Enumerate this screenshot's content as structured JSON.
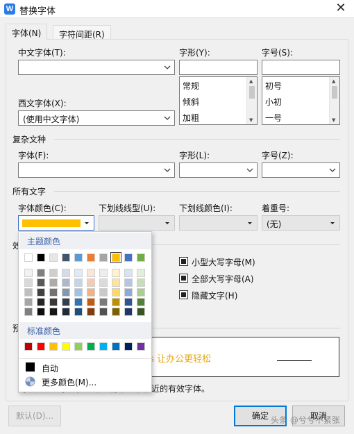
{
  "window": {
    "title": "替换字体",
    "app_icon_letter": "W"
  },
  "tabs": [
    {
      "label": "字体(N)"
    },
    {
      "label": "字符间距(R)"
    }
  ],
  "font": {
    "chinese_label": "中文字体(T):",
    "chinese_value": "",
    "western_label": "西文字体(X):",
    "western_value": "(使用中文字体)",
    "style_label": "字形(Y):",
    "style_value": "",
    "style_options": [
      "常规",
      "倾斜",
      "加粗"
    ],
    "size_label": "字号(S):",
    "size_value": "",
    "size_options": [
      "初号",
      "小初",
      "一号"
    ]
  },
  "complex": {
    "section": "复杂文种",
    "font_label": "字体(F):",
    "style_label": "字形(L):",
    "size_label": "字号(Z):"
  },
  "all_text": {
    "section": "所有文字",
    "color_label": "字体颜色(C):",
    "color_value": "#ffc000",
    "underline_type_label": "下划线线型(U):",
    "underline_color_label": "下划线颜色(I):",
    "emphasis_label": "着重号:",
    "emphasis_value": "(无)"
  },
  "effects": {
    "section_partial": "效",
    "small_caps": "小型大写字母(M)",
    "all_caps": "全部大写字母(A)",
    "hidden": "隐藏文字(H)"
  },
  "preview": {
    "section_partial": "预",
    "sample": "ps 让办公更轻松",
    "sample_color": "#e6a817",
    "note_partial": "尚未安装此字体，打印时将采用最相近的有效字体。"
  },
  "buttons": {
    "default": "默认(D)...",
    "ok": "确定",
    "cancel": "取消"
  },
  "color_popup": {
    "theme_title": "主题颜色",
    "standard_title": "标准颜色",
    "auto_label": "自动",
    "more_label": "更多颜色(M)...",
    "theme_row": [
      "#ffffff",
      "#000000",
      "#e7e6e6",
      "#44546a",
      "#5b9bd5",
      "#ed7d31",
      "#a5a5a5",
      "#ffc000",
      "#4472c4",
      "#70ad47"
    ],
    "theme_shades": [
      [
        "#f2f2f2",
        "#808080",
        "#d0cece",
        "#d6dce4",
        "#deebf6",
        "#fbe5d5",
        "#ededed",
        "#fff2cc",
        "#d9e2f3",
        "#e2efd9"
      ],
      [
        "#d9d9d9",
        "#595959",
        "#aeaaaa",
        "#adb9ca",
        "#bdd7ee",
        "#f7cbac",
        "#dbdbdb",
        "#fee599",
        "#b4c6e7",
        "#c5e0b3"
      ],
      [
        "#bfbfbf",
        "#404040",
        "#757171",
        "#8496b0",
        "#9dc3e6",
        "#f4b183",
        "#c9c9c9",
        "#ffd965",
        "#8eaadb",
        "#a8d08d"
      ],
      [
        "#a6a6a6",
        "#262626",
        "#3a3838",
        "#333f4f",
        "#2e75b5",
        "#c55a11",
        "#7b7b7b",
        "#bf8f00",
        "#2f5496",
        "#538135"
      ],
      [
        "#808080",
        "#0d0d0d",
        "#171616",
        "#222a35",
        "#1e4e79",
        "#833c0b",
        "#525252",
        "#7f6000",
        "#1f3864",
        "#375623"
      ]
    ],
    "standard_row": [
      "#c00000",
      "#ff0000",
      "#ffc000",
      "#ffff00",
      "#92d050",
      "#00b050",
      "#00b0f0",
      "#0070c0",
      "#002060",
      "#7030a0"
    ],
    "selected_theme_index": 7
  },
  "watermark": "头条 @兮兮不紧张"
}
